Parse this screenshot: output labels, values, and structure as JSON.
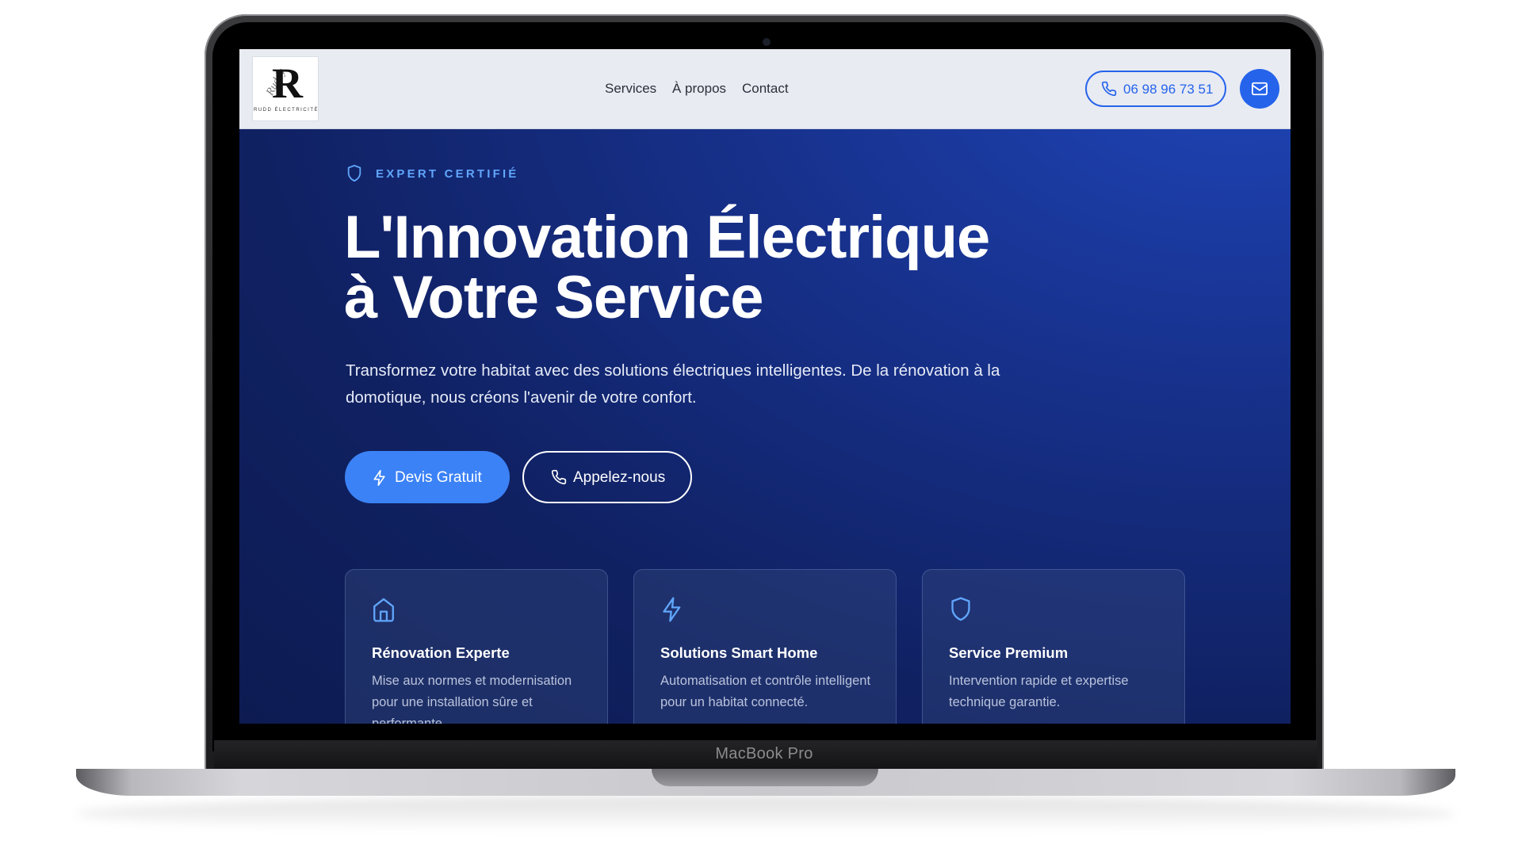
{
  "device_label": "MacBook Pro",
  "header": {
    "logo": {
      "letter": "R",
      "script": "Ruddy",
      "sub": "RUDD ÉLECTRICITÉ"
    },
    "nav": [
      {
        "label": "Services"
      },
      {
        "label": "À propos"
      },
      {
        "label": "Contact"
      }
    ],
    "phone": "06 98 96 73 51",
    "mail_icon": "mail-icon"
  },
  "hero": {
    "badge": "EXPERT CERTIFIÉ",
    "title_line1": "L'Innovation Électrique",
    "title_line2": "à Votre Service",
    "subtitle": "Transformez votre habitat avec des solutions électriques intelligentes. De la rénovation à la domotique, nous créons l'avenir de votre confort.",
    "primary_cta": "Devis Gratuit",
    "secondary_cta": "Appelez-nous"
  },
  "cards": [
    {
      "icon": "home-icon",
      "title": "Rénovation Experte",
      "text": "Mise aux normes et modernisation pour une installation sûre et performante"
    },
    {
      "icon": "bolt-icon",
      "title": "Solutions Smart Home",
      "text": "Automatisation et contrôle intelligent pour un habitat connecté."
    },
    {
      "icon": "shield-icon",
      "title": "Service Premium",
      "text": "Intervention rapide et expertise technique garantie."
    }
  ],
  "colors": {
    "accent": "#3b82f6",
    "brand_blue": "#2563eb",
    "badge_text": "#60a5fa",
    "hero_bg_dark": "#0d1b52",
    "hero_bg_light": "#1f45b8",
    "header_bg": "#e8ebf2"
  }
}
